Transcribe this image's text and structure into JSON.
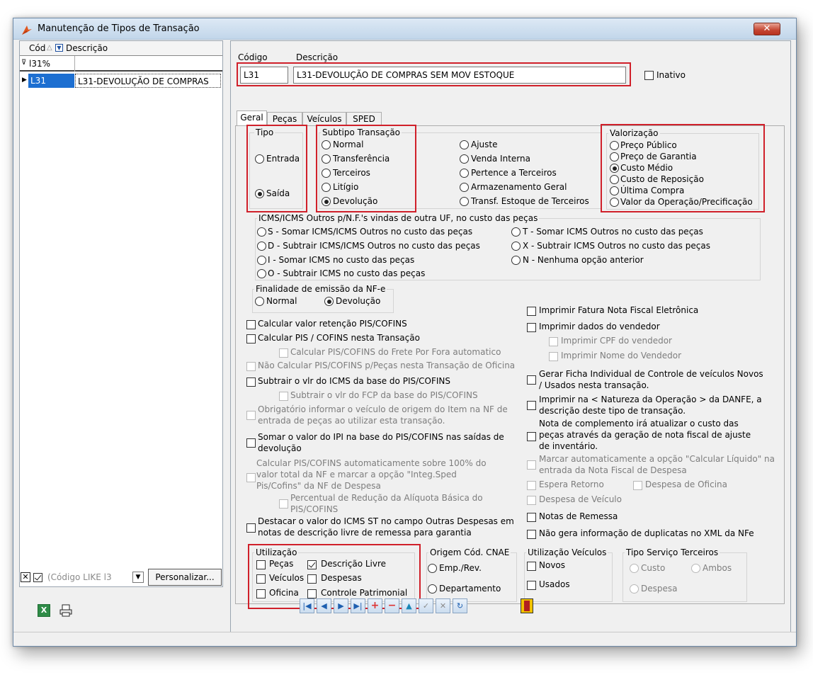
{
  "window": {
    "title": "Manutenção de Tipos de Transação",
    "close_label": "✕"
  },
  "grid": {
    "columns": [
      "Cód",
      "Descrição"
    ],
    "filter_value": "l31%",
    "rows": [
      {
        "code": "L31",
        "description": "L31-DEVOLUÇÃO DE COMPRAS"
      }
    ],
    "filter_text": "(Código LIKE l3",
    "customize_label": "Personalizar..."
  },
  "form": {
    "code_label": "Código",
    "description_label": "Descrição",
    "code_value": "L31",
    "description_value": "L31-DEVOLUÇÃO DE COMPRAS SEM MOV ESTOQUE",
    "inactive_label": "Inativo"
  },
  "tabs": [
    "Geral",
    "Peças",
    "Veículos",
    "SPED"
  ],
  "tipo": {
    "title": "Tipo",
    "options": [
      "Entrada",
      "Saída"
    ],
    "selected": "Saída"
  },
  "subtipo": {
    "title": "Subtipo Transação",
    "col1": [
      "Normal",
      "Transferência",
      "Terceiros",
      "Litígio",
      "Devolução"
    ],
    "col2": [
      "Ajuste",
      "Venda Interna",
      "Pertence a Terceiros",
      "Armazenamento Geral",
      "Transf. Estoque de Terceiros"
    ],
    "selected": "Devolução"
  },
  "valorizacao": {
    "title": "Valorização",
    "options": [
      "Preço Público",
      "Preço de Garantia",
      "Custo Médio",
      "Custo de Reposição",
      "Última Compra",
      "Valor da Operação/Precificação"
    ],
    "selected": "Custo Médio"
  },
  "icms": {
    "title": "ICMS/ICMS Outros p/N.F.'s vindas de outra UF, no custo das peças",
    "col1": [
      "S - Somar ICMS/ICMS Outros no custo das peças",
      "D - Subtrair ICMS/ICMS Outros no custo das peças",
      "I - Somar ICMS no custo das peças",
      "O - Subtrair ICMS no custo das peças"
    ],
    "col2": [
      "T - Somar ICMS Outros no custo das peças",
      "X - Subtrair ICMS Outros no custo das peças",
      "N - Nenhuma opção anterior"
    ]
  },
  "finalidade": {
    "title": "Finalidade de emissão da NF-e",
    "options": [
      "Normal",
      "Devolução"
    ],
    "selected": "Devolução"
  },
  "left_checks": [
    "Calcular valor retenção PIS/COFINS",
    "Calcular PIS / COFINS nesta Transação",
    "Calcular PIS/COFINS do Frete Por Fora automatico",
    "Não Calcular PIS/COFINS p/Peças nesta Transação de Oficina",
    "Subtrair o vlr do ICMS da base do PIS/COFINS",
    "Subtrair o vlr do FCP da base do PIS/COFINS",
    "Obrigatório informar o veículo de origem do Item na NF de entrada de peças ao utilizar esta transação.",
    "Somar o valor do IPI na base do PIS/COFINS nas saídas de devolução",
    "Calcular PIS/COFINS automaticamente sobre 100% do valor total da NF e marcar a opção \"Integ.Sped Pis/Cofins\" da NF de Despesa",
    "Percentual de Redução da Alíquota Básica do PIS/COFINS",
    "Destacar o valor do ICMS ST no campo Outras Despesas em notas de descrição livre de remessa para garantia"
  ],
  "right_checks": [
    "Imprimir Fatura Nota Fiscal Eletrônica",
    "Imprimir dados do vendedor",
    "Imprimir CPF do vendedor",
    "Imprimir Nome do Vendedor",
    "Gerar Ficha Individual de Controle de veículos Novos / Usados  nesta transação.",
    "Imprimir na < Natureza da Operação > da DANFE, a descrição deste tipo de transação.",
    "Nota de complemento irá atualizar o custo das peças através da geração de nota fiscal de ajuste de inventário.",
    "Marcar automaticamente a opção \"Calcular Líquido\" na entrada da Nota Fiscal de Despesa",
    "Espera Retorno",
    "Despesa de Oficina",
    "Despesa de Veículo",
    "Notas de Remessa",
    "Não gera informação de duplicatas no XML da NFe"
  ],
  "utilizacao": {
    "title": "Utilização",
    "items": [
      "Peças",
      "Descrição Livre",
      "Veículos",
      "Despesas",
      "Oficina",
      "Controle Patrimonial"
    ],
    "checked": [
      "Descrição Livre"
    ]
  },
  "cnae": {
    "title": "Origem Cód. CNAE",
    "options": [
      "Emp./Rev.",
      "Departamento"
    ]
  },
  "util_veic": {
    "title": "Utilização Veículos",
    "items": [
      "Novos",
      "Usados"
    ]
  },
  "servico": {
    "title": "Tipo Serviço Terceiros",
    "options": [
      "Custo",
      "Ambos",
      "Despesa"
    ]
  },
  "nav_icons": [
    "first-icon",
    "prev-icon",
    "next-icon",
    "last-icon",
    "add-icon",
    "delete-icon",
    "edit-icon",
    "confirm-icon",
    "cancel-icon",
    "refresh-icon",
    "exit-icon"
  ],
  "colors": {
    "highlight_red": "#d0202a",
    "selection_blue": "#1d6fd1"
  }
}
